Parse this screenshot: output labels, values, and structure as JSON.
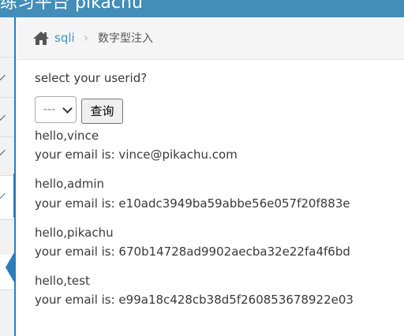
{
  "header": {
    "title": "练习平台 pikachu"
  },
  "breadcrumb": {
    "home_label": "sqli",
    "separator": "›",
    "current": "数字型注入"
  },
  "form": {
    "prompt": "select your userid?",
    "select_value": "---",
    "submit_label": "查询"
  },
  "results": [
    {
      "hello": "hello,vince",
      "email": "your email is: vince@pikachu.com"
    },
    {
      "hello": "hello,admin",
      "email": "your email is: e10adc3949ba59abbe56e057f20f883e"
    },
    {
      "hello": "hello,pikachu",
      "email": "your email is: 670b14728ad9902aecba32e22fa4f6bd"
    },
    {
      "hello": "hello,test",
      "email": "your email is: e99a18c428cb38d5f260853678922e03"
    }
  ],
  "colors": {
    "navbar": "#438eb9",
    "accent": "#2b7dbc",
    "link": "#4c8fbd"
  },
  "icons": {
    "home": "home-icon",
    "collapse": "collapse-arrow-icon",
    "chevron": "chevron-down-icon"
  }
}
